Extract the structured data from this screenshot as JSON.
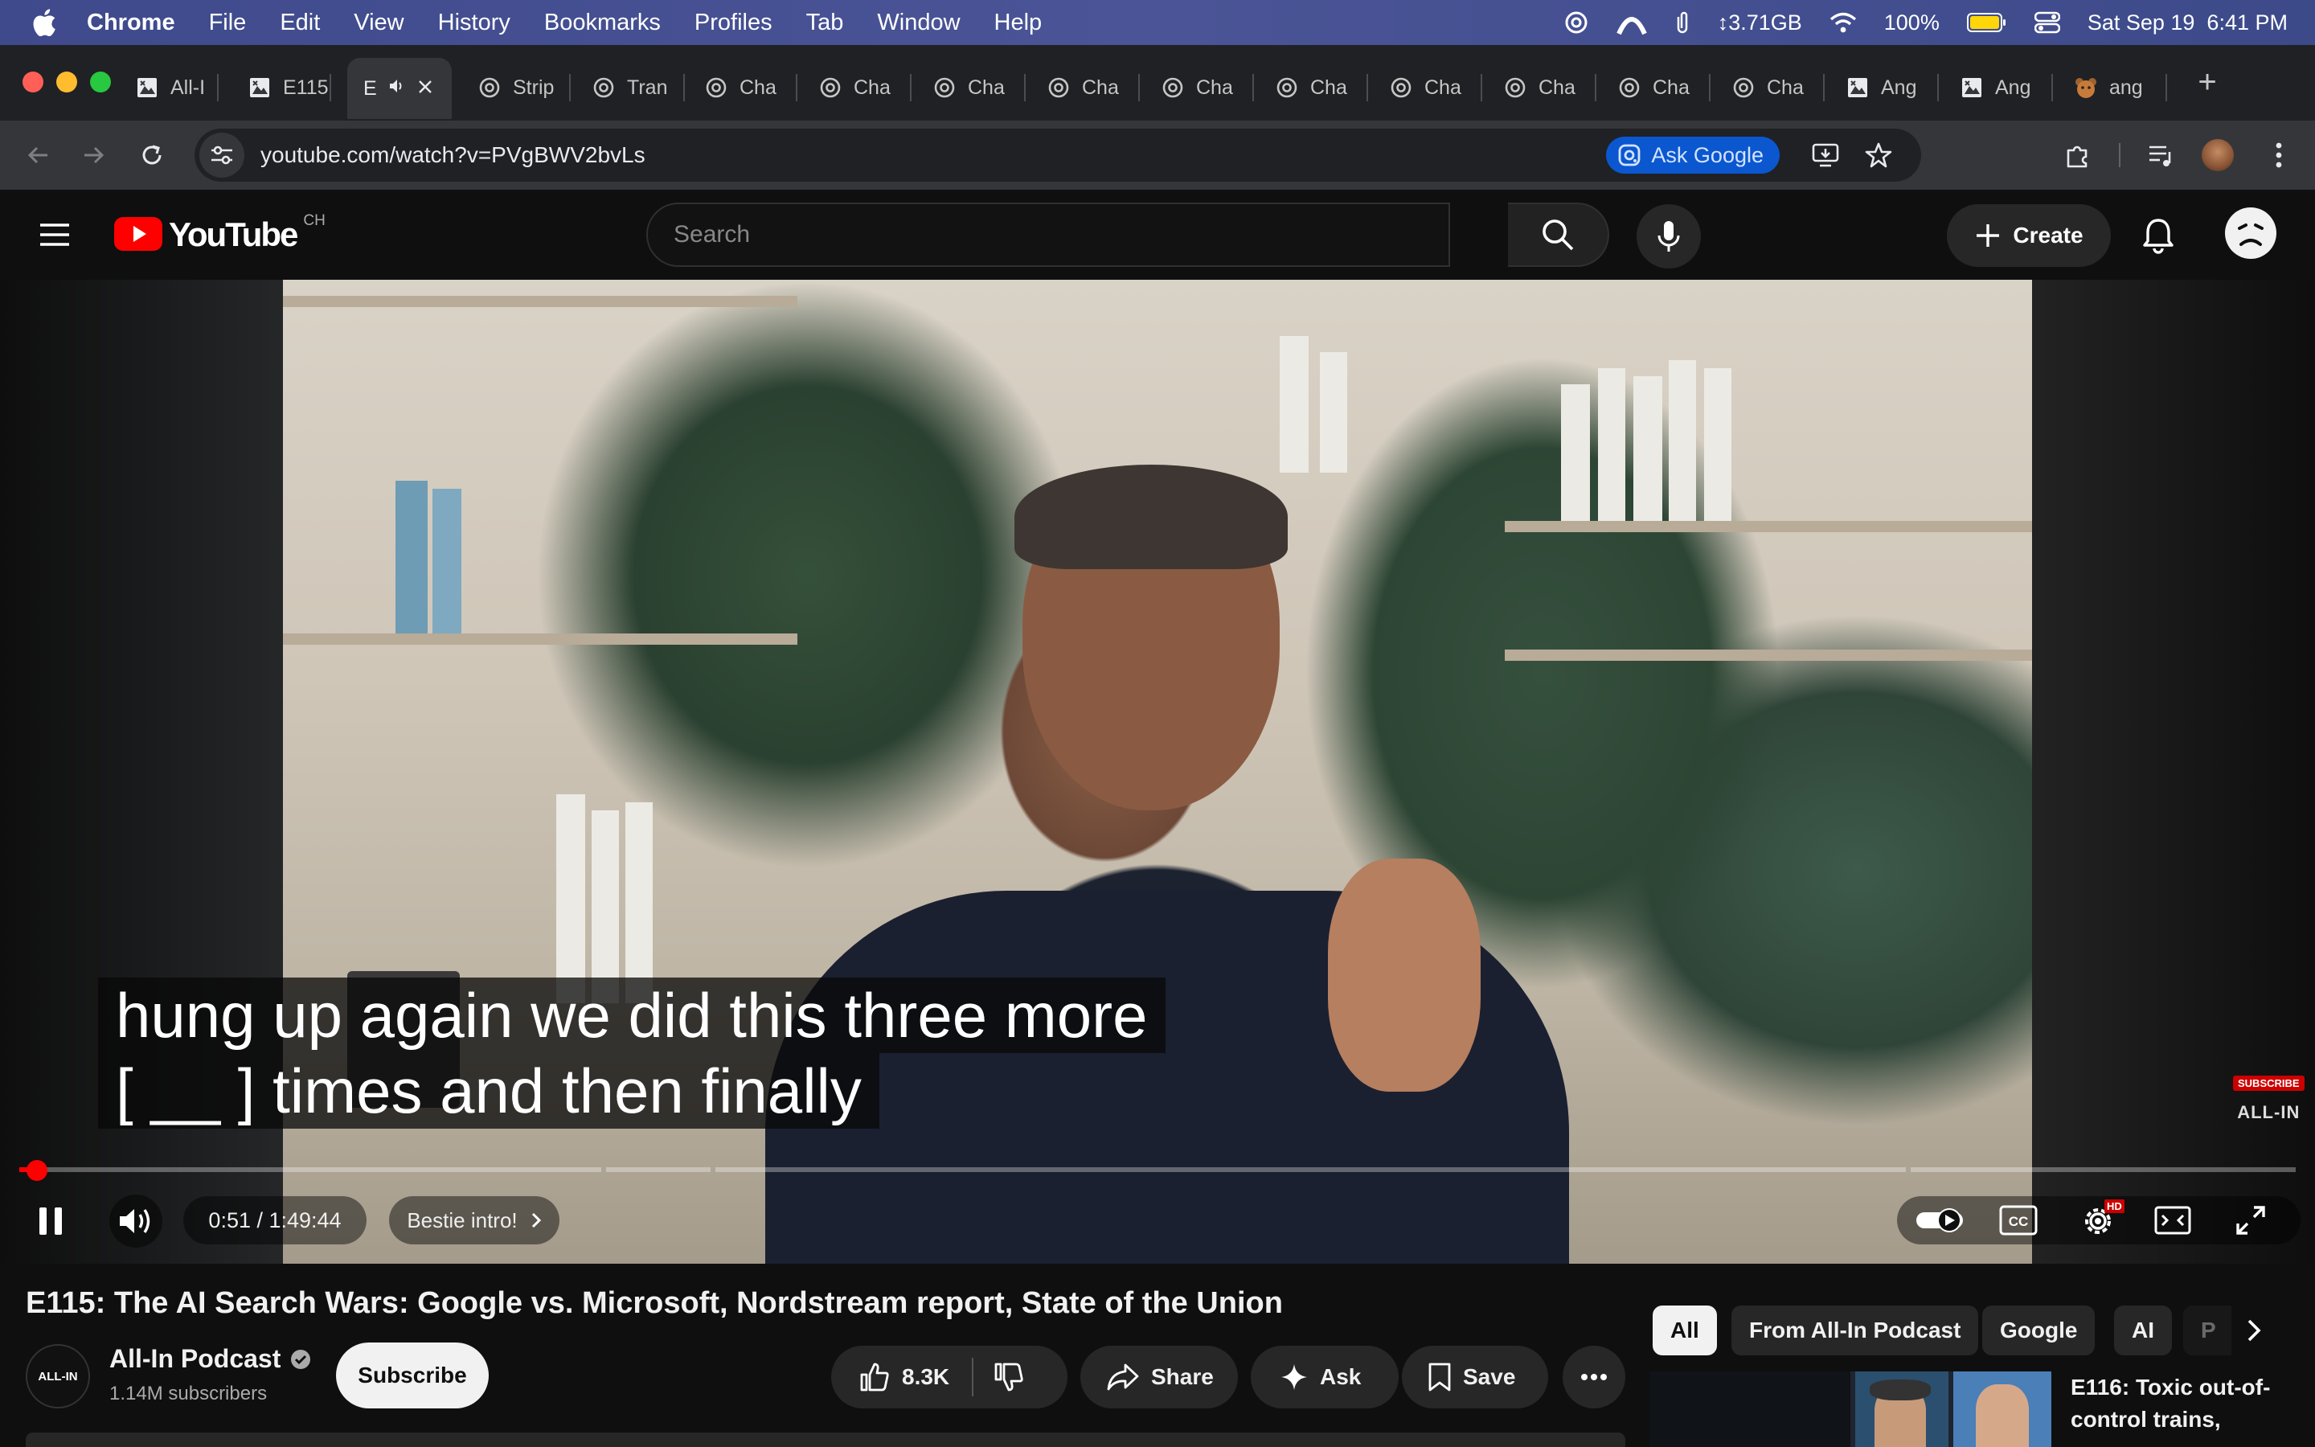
{
  "menubar": {
    "app_name": "Chrome",
    "items": [
      "File",
      "Edit",
      "View",
      "History",
      "Bookmarks",
      "Profiles",
      "Tab",
      "Window",
      "Help"
    ],
    "memory": "3.71GB",
    "battery": "100%",
    "datetime": "Sat Sep 19  6:41 PM"
  },
  "tabs": [
    {
      "label": "All-I",
      "icon": "image-icon"
    },
    {
      "label": "E115",
      "icon": "image-icon"
    },
    {
      "label": "E",
      "icon": "image-icon",
      "active": true
    },
    {
      "label": "Strip",
      "icon": "openai-icon"
    },
    {
      "label": "Tran",
      "icon": "openai-icon"
    },
    {
      "label": "Cha",
      "icon": "openai-icon"
    },
    {
      "label": "Cha",
      "icon": "openai-icon"
    },
    {
      "label": "Cha",
      "icon": "openai-icon"
    },
    {
      "label": "Cha",
      "icon": "openai-icon"
    },
    {
      "label": "Cha",
      "icon": "openai-icon"
    },
    {
      "label": "Cha",
      "icon": "openai-icon"
    },
    {
      "label": "Cha",
      "icon": "openai-icon"
    },
    {
      "label": "Cha",
      "icon": "openai-icon"
    },
    {
      "label": "Cha",
      "icon": "openai-icon"
    },
    {
      "label": "Cha",
      "icon": "openai-icon"
    },
    {
      "label": "Ang",
      "icon": "image-icon"
    },
    {
      "label": "Ang",
      "icon": "image-icon"
    },
    {
      "label": "ang",
      "icon": "bear-icon"
    }
  ],
  "omnibox": {
    "url": "youtube.com/watch?v=PVgBWV2bvLs",
    "ask_google": "Ask Google"
  },
  "youtube": {
    "logo_text": "YouTube",
    "country": "CH",
    "search_placeholder": "Search",
    "create_label": "Create"
  },
  "player": {
    "subtitle_line1": "hung up again we did this three more",
    "subtitle_line2": "[ __ ] times and then finally",
    "time": "0:51 / 1:49:44",
    "chapter": "Bestie intro!",
    "progress_fraction": 0.0077,
    "watermark_sub": "SUBSCRIBE",
    "watermark_name": "ALL-IN",
    "hd_badge": "HD"
  },
  "video": {
    "title": "E115: The AI Search Wars: Google vs. Microsoft, Nordstream report, State of the Union",
    "channel_name": "All-In Podcast",
    "channel_avatar_text": "ALL-IN",
    "subscribers": "1.14M subscribers",
    "subscribe_label": "Subscribe",
    "likes": "8.3K",
    "share_label": "Share",
    "ask_label": "Ask",
    "save_label": "Save"
  },
  "chips": [
    "All",
    "From All-In Podcast",
    "Google",
    "AI",
    "P"
  ],
  "recommendation": {
    "title": "E116: Toxic out-of-control trains,"
  },
  "colors": {
    "youtube_red": "#ff0000",
    "menubar_bg": "#4a5496",
    "ask_google_bg": "#0b57d0"
  }
}
